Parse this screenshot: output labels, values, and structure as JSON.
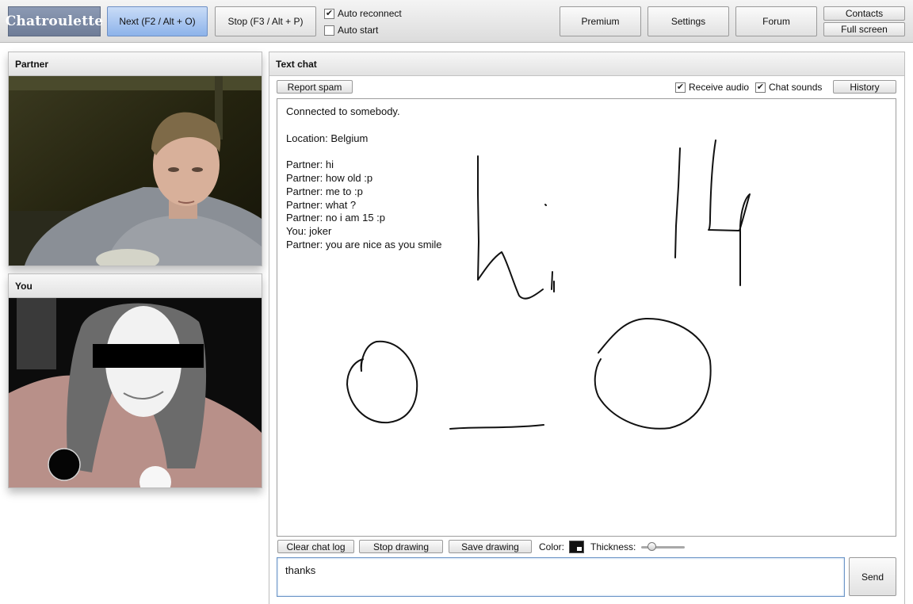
{
  "app": {
    "logo": "Chatroulette"
  },
  "toolbar": {
    "next_label": "Next (F2 / Alt + O)",
    "stop_label": "Stop (F3 / Alt + P)",
    "auto_reconnect": {
      "label": "Auto reconnect",
      "checked": true
    },
    "auto_start": {
      "label": "Auto start",
      "checked": false
    },
    "premium_label": "Premium",
    "settings_label": "Settings",
    "forum_label": "Forum",
    "contacts_label": "Contacts",
    "fullscreen_label": "Full screen"
  },
  "partner_panel": {
    "title": "Partner"
  },
  "you_panel": {
    "title": "You"
  },
  "chat": {
    "title": "Text chat",
    "report_spam_label": "Report spam",
    "receive_audio": {
      "label": "Receive audio",
      "checked": true
    },
    "chat_sounds": {
      "label": "Chat sounds",
      "checked": true
    },
    "history_label": "History",
    "lines": [
      "Connected to somebody.",
      "",
      "Location: Belgium",
      "",
      "Partner: hi",
      "Partner: how old :p",
      "Partner: me to :p",
      "Partner: what ?",
      "Partner: no i am 15 :p",
      "You: joker",
      "Partner: you are nice as you smile"
    ]
  },
  "bottom": {
    "clear_label": "Clear chat log",
    "stop_drawing_label": "Stop drawing",
    "save_drawing_label": "Save drawing",
    "color_label": "Color:",
    "thickness_label": "Thickness:",
    "thickness_value": 0.15,
    "draw_color": "#111111",
    "message_value": "thanks",
    "send_label": "Send"
  },
  "colors": {
    "accent": "#8db3ea",
    "logo_bg": "#7b89a4"
  }
}
